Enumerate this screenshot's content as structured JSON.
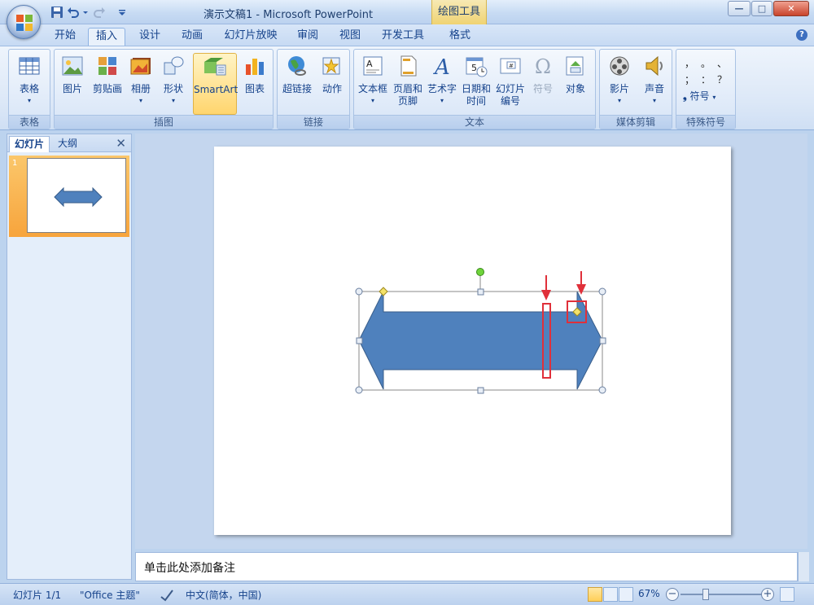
{
  "window": {
    "title": "演示文稿1 - Microsoft PowerPoint",
    "context_tab_title": "绘图工具"
  },
  "tabs": [
    "开始",
    "插入",
    "设计",
    "动画",
    "幻灯片放映",
    "审阅",
    "视图",
    "开发工具",
    "格式"
  ],
  "active_tab": "插入",
  "ribbon": {
    "groups": {
      "tables": "表格",
      "illustrations": "插图",
      "links": "链接",
      "text": "文本",
      "media": "媒体剪辑",
      "special_symbols": "特殊符号"
    },
    "buttons": {
      "table": "表格",
      "picture": "图片",
      "clipart": "剪贴画",
      "album": "相册",
      "shapes": "形状",
      "smartart": "SmartArt",
      "chart": "图表",
      "hyperlink": "超链接",
      "action": "动作",
      "textbox": "文本框",
      "header_footer_1": "页眉和",
      "header_footer_2": "页脚",
      "wordart": "艺术字",
      "datetime_1": "日期和",
      "datetime_2": "时间",
      "slide_number_1": "幻灯片",
      "slide_number_2": "编号",
      "symbol": "符号",
      "object": "对象",
      "movie": "影片",
      "sound": "声音",
      "special_symbol": "符号"
    },
    "special_chars": [
      "，",
      "。",
      "、",
      "；",
      "：",
      "？"
    ]
  },
  "left_pane": {
    "tab_slides": "幻灯片",
    "tab_outline": "大纲",
    "slide_number": "1"
  },
  "notes_placeholder": "单击此处添加备注",
  "status": {
    "slide": "幻灯片 1/1",
    "theme": "\"Office 主题\"",
    "language": "中文(简体，中国)",
    "zoom": "67%"
  },
  "colors": {
    "arrow_fill": "#4f81bd",
    "arrow_stroke": "#385d8a",
    "annotation": "#e0303a",
    "adjust_handle": "#f3e26a",
    "rotate_handle": "#6fd43b"
  }
}
